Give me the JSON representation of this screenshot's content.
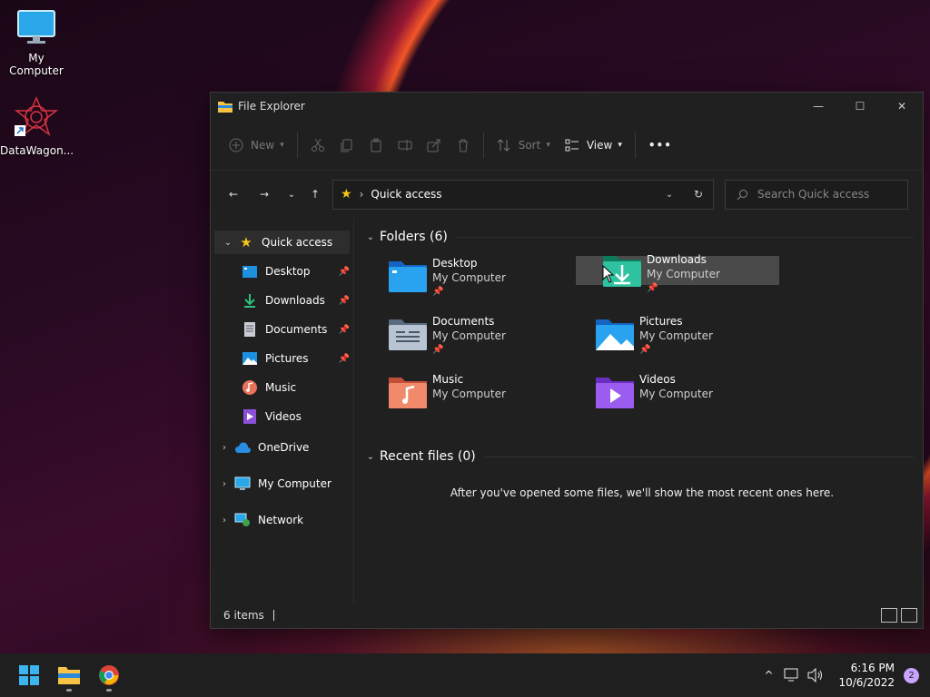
{
  "desktop": {
    "icons": [
      {
        "label": "My Computer"
      },
      {
        "label": "DataWagon..."
      }
    ]
  },
  "window": {
    "title": "File Explorer",
    "controls": {
      "minimize": "—",
      "maximize": "☐",
      "close": "✕"
    }
  },
  "toolbar": {
    "new_label": "New",
    "sort_label": "Sort",
    "view_label": "View",
    "more_label": "•••"
  },
  "navigation": {
    "address_crumb": "Quick access",
    "search_placeholder": "Search Quick access"
  },
  "sidebar": {
    "quick_access": "Quick access",
    "pinned": [
      {
        "label": "Desktop"
      },
      {
        "label": "Downloads"
      },
      {
        "label": "Documents"
      },
      {
        "label": "Pictures"
      },
      {
        "label": "Music"
      },
      {
        "label": "Videos"
      }
    ],
    "onedrive": "OneDrive",
    "my_computer": "My Computer",
    "network": "Network"
  },
  "main": {
    "folders_header": "Folders (6)",
    "folders": [
      {
        "name": "Desktop",
        "location": "My Computer",
        "pinned": true
      },
      {
        "name": "Downloads",
        "location": "My Computer",
        "pinned": true
      },
      {
        "name": "Documents",
        "location": "My Computer",
        "pinned": true
      },
      {
        "name": "Pictures",
        "location": "My Computer",
        "pinned": true
      },
      {
        "name": "Music",
        "location": "My Computer",
        "pinned": false
      },
      {
        "name": "Videos",
        "location": "My Computer",
        "pinned": false
      }
    ],
    "recent_header": "Recent files (0)",
    "recent_empty_message": "After you've opened some files, we'll show the most recent ones here."
  },
  "status": {
    "item_count": "6 items"
  },
  "taskbar": {
    "time": "6:16 PM",
    "date": "10/6/2022",
    "notification_count": "2"
  },
  "colors": {
    "accent": "#0078d4",
    "window_bg": "#202020",
    "hover_tile": "#4a4a4a"
  }
}
